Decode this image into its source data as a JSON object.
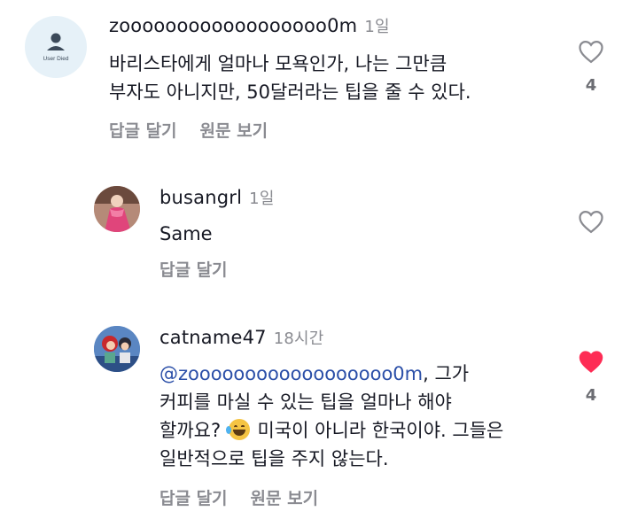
{
  "comments": [
    {
      "username": "zoooooooooooooooooo0m",
      "time": "1일",
      "avatar_text": "User Died",
      "lines": [
        "바리스타에게 얼마나 모욕인가, 나는 그만큼",
        "부자도 아니지만, 50달러라는 팁을 줄 수 있다."
      ],
      "actions": [
        "답글 달기",
        "원문 보기"
      ],
      "likes": "4",
      "liked": false
    },
    {
      "username": "busangrl",
      "time": "1일",
      "lines": [
        "Same"
      ],
      "actions": [
        "답글 달기"
      ],
      "likes": "",
      "liked": false
    },
    {
      "username": "catname47",
      "time": "18시간",
      "mention": "@zoooooooooooooooooo0m",
      "line1_rest": ", 그가",
      "line2": "커피를 마실 수 있는 팁을 얼마나 해야",
      "line3_a": "할까요?",
      "line3_b": "미국이 아니라 한국이야. 그들은",
      "line4": "일반적으로 팁을 주지 않는다.",
      "actions": [
        "답글 달기",
        "원문 보기"
      ],
      "likes": "4",
      "liked": true
    }
  ],
  "colors": {
    "username": "#161823",
    "meta": "#8a8b91",
    "mention": "#2b4fa8",
    "like_active": "#fe2c55",
    "like_inactive": "#8a8b91"
  },
  "icons": {
    "like": "heart-outline-icon",
    "liked": "heart-filled-icon",
    "emoji": "laughing-tears-emoji"
  }
}
